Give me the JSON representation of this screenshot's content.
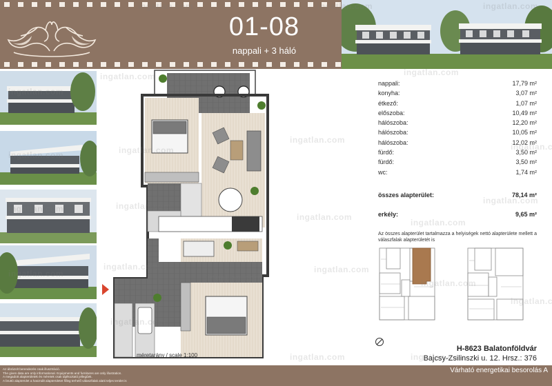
{
  "header": {
    "unit_number": "01-08",
    "unit_rooms": "nappali + 3 háló"
  },
  "areas": [
    {
      "name": "nappali:",
      "value": "17,79 m²"
    },
    {
      "name": "konyha:",
      "value": "3,07 m²"
    },
    {
      "name": "étkező:",
      "value": "1,07 m²"
    },
    {
      "name": "előszoba:",
      "value": "10,49 m²"
    },
    {
      "name": "hálószoba:",
      "value": "12,20 m²"
    },
    {
      "name": "hálószoba:",
      "value": "10,05 m²"
    },
    {
      "name": "hálószoba:",
      "value": "12,02 m²"
    },
    {
      "name": "fürdő:",
      "value": "3,50 m²"
    },
    {
      "name": "fürdő:",
      "value": "3,50 m²"
    },
    {
      "name": "wc:",
      "value": "1,74 m²"
    }
  ],
  "totals": {
    "total_label": "összes alapterület:",
    "total_value": "78,14 m²",
    "balcony_label": "erkély:",
    "balcony_value": "9,65 m²"
  },
  "note": "Az összes alapterület tartalmazza a helyiségek nettó alapterülete mellett a válaszfalak alapterületét is",
  "scale_label": "méretarány / scale 1:100",
  "address": {
    "city": "H-8623 Balatonföldvár",
    "street": "Bajcsy-Zsilinszki u. 12. Hrsz.: 376"
  },
  "footer": {
    "disclaimer_lines": [
      "Az ábrázolt berendezés csak illusztráció.",
      "The given data are only informational. Equipments and furnitures are only illustration.",
      "A megadott alapterületek és méretek csak tájékoztató jellegűek.",
      "A bruttó alapterület a használt alapterületet főleg terhelő válaszfalak alatti teljes terület is"
    ],
    "energy": "Várható energetikai besorolás A"
  },
  "watermark": "ingatlan.com",
  "colors": {
    "brand": "#8d7463",
    "highlight_unit": "#a9794f",
    "entry_arrow": "#d9452e"
  }
}
